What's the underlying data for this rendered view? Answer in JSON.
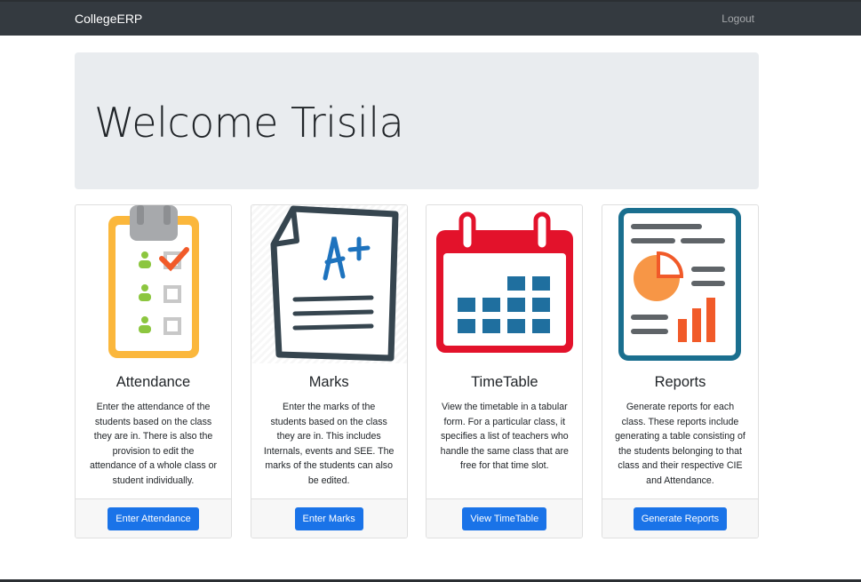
{
  "navbar": {
    "brand": "CollegeERP",
    "logout": "Logout"
  },
  "jumbotron": {
    "heading": "Welcome Trisila"
  },
  "cards": [
    {
      "title": "Attendance",
      "text": "Enter the attendance of the students based on the class they are in. There is also the provision to edit the attendance of a whole class or student individually.",
      "button": "Enter Attendance",
      "icon": "clipboard-checklist-icon"
    },
    {
      "title": "Marks",
      "text": "Enter the marks of the students based on the class they are in. This includes Internals, events and SEE. The marks of the students can also be edited.",
      "button": "Enter Marks",
      "icon": "graded-paper-icon"
    },
    {
      "title": "TimeTable",
      "text": "View the timetable in a tabular form. For a particular class, it specifies a list of teachers who handle the same class that are free for that time slot.",
      "button": "View TimeTable",
      "icon": "calendar-icon"
    },
    {
      "title": "Reports",
      "text": "Generate reports for each class. These reports include generating a table consisting of the students belonging to that class and their respective CIE and Attendance.",
      "button": "Generate Reports",
      "icon": "report-chart-icon"
    }
  ],
  "colors": {
    "navbar": "#343a40",
    "jumbotron": "#e9ecef",
    "button": "#1a73e8"
  }
}
